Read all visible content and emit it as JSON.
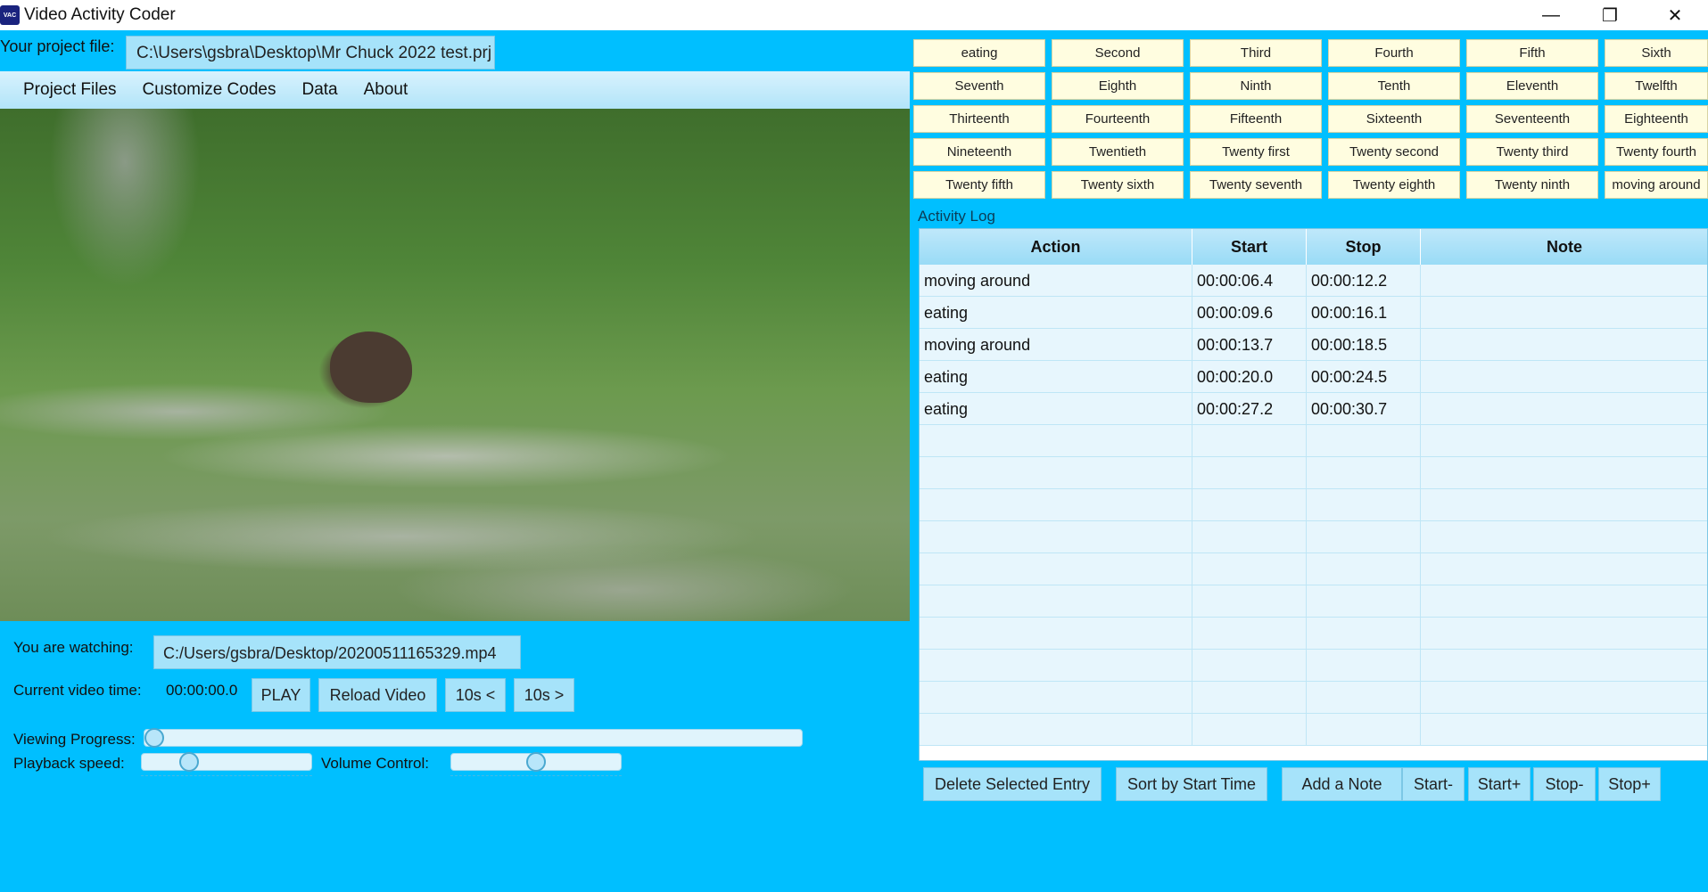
{
  "window": {
    "title": "Video Activity Coder",
    "icon_text": "VAC",
    "min_glyph": "—",
    "max_glyph": "❐",
    "close_glyph": "✕"
  },
  "project": {
    "label": "Your project file:",
    "path": "C:\\Users\\gsbra\\Desktop\\Mr Chuck 2022 test.prj"
  },
  "menu": [
    "Project Files",
    "Customize Codes",
    "Data",
    "About"
  ],
  "player": {
    "watching_label": "You are watching:",
    "watching_path": "C:/Users/gsbra/Desktop/20200511165329.mp4",
    "time_label": "Current video time:",
    "time_value": "00:00:00.0",
    "play": "PLAY",
    "reload": "Reload Video",
    "back10": "10s <",
    "fwd10": "10s >",
    "progress_label": "Viewing Progress:",
    "progress_value": 0.0,
    "speed_label": "Playback speed:",
    "speed_value": 0.25,
    "volume_label": "Volume Control:",
    "volume_value": 0.5
  },
  "codes": [
    [
      "eating",
      "Second",
      "Third",
      "Fourth",
      "Fifth",
      "Sixth"
    ],
    [
      "Seventh",
      "Eighth",
      "Ninth",
      "Tenth",
      "Eleventh",
      "Twelfth"
    ],
    [
      "Thirteenth",
      "Fourteenth",
      "Fifteenth",
      "Sixteenth",
      "Seventeenth",
      "Eighteenth"
    ],
    [
      "Nineteenth",
      "Twentieth",
      "Twenty first",
      "Twenty second",
      "Twenty third",
      "Twenty fourth"
    ],
    [
      "Twenty fifth",
      "Twenty sixth",
      "Twenty seventh",
      "Twenty eighth",
      "Twenty ninth",
      "moving around"
    ]
  ],
  "log": {
    "label": "Activity Log",
    "columns": [
      "Action",
      "Start",
      "Stop",
      "Note"
    ],
    "rows": [
      [
        "moving around",
        "00:00:06.4",
        "00:00:12.2",
        ""
      ],
      [
        "eating",
        "00:00:09.6",
        "00:00:16.1",
        ""
      ],
      [
        "moving around",
        "00:00:13.7",
        "00:00:18.5",
        ""
      ],
      [
        "eating",
        "00:00:20.0",
        "00:00:24.5",
        ""
      ],
      [
        "eating",
        "00:00:27.2",
        "00:00:30.7",
        ""
      ],
      [
        "",
        "",
        "",
        ""
      ],
      [
        "",
        "",
        "",
        ""
      ],
      [
        "",
        "",
        "",
        ""
      ],
      [
        "",
        "",
        "",
        ""
      ],
      [
        "",
        "",
        "",
        ""
      ],
      [
        "",
        "",
        "",
        ""
      ],
      [
        "",
        "",
        "",
        ""
      ],
      [
        "",
        "",
        "",
        ""
      ],
      [
        "",
        "",
        "",
        ""
      ],
      [
        "",
        "",
        "",
        ""
      ]
    ]
  },
  "actions": [
    "Delete Selected Entry",
    "Sort by Start Time",
    "Add a Note",
    "Start-",
    "Start+",
    "Stop-",
    "Stop+"
  ]
}
